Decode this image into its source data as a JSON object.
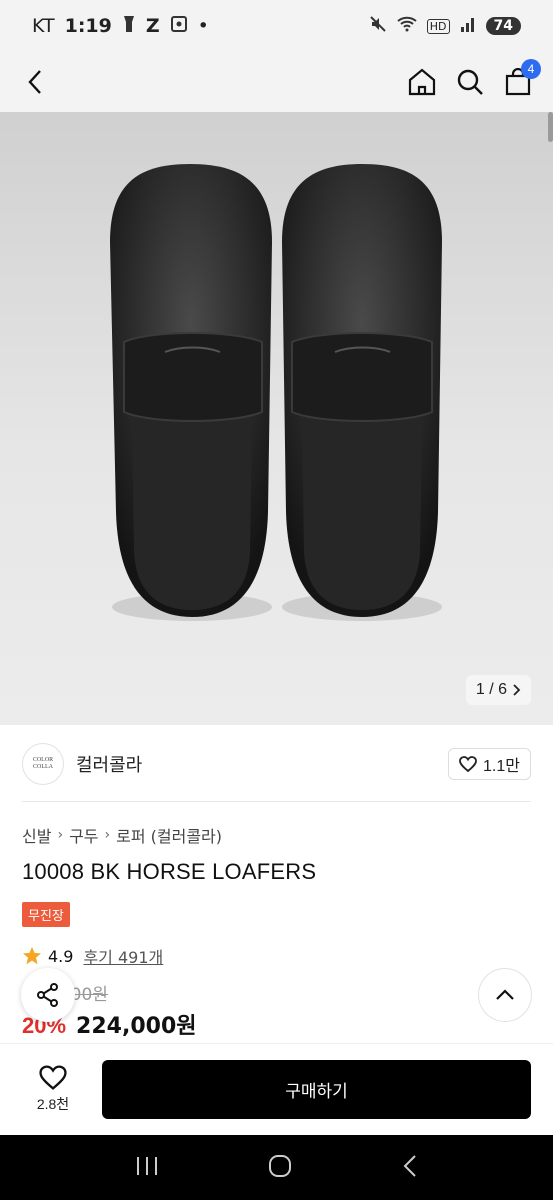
{
  "status": {
    "carrier": "KT",
    "time": "1:19",
    "battery": "74",
    "network": "HD"
  },
  "header": {
    "cart_count": "4"
  },
  "gallery": {
    "counter": "1 / 6"
  },
  "store": {
    "logo_line1": "COLOR",
    "logo_line2": "COLLA",
    "name": "컬러콜라",
    "likes": "1.1만"
  },
  "breadcrumb": {
    "items": [
      "신발",
      "구두",
      "로퍼 (컬러콜라)"
    ]
  },
  "product": {
    "title": "10008 BK HORSE LOAFERS",
    "badge": "무진장",
    "rating": "4.9",
    "reviews": "후기 491개",
    "original_price": "280,000원",
    "discount": "20%",
    "price": "224,000원"
  },
  "bottom": {
    "wish_count": "2.8천",
    "buy_label": "구매하기"
  },
  "colors": {
    "accent_blue": "#2d6bf0",
    "discount_red": "#e0302b",
    "badge_orange": "#ec5b3c",
    "star": "#f5a623"
  }
}
